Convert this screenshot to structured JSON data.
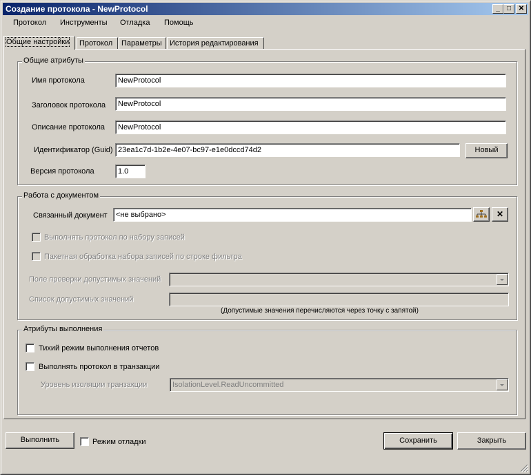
{
  "window": {
    "title": "Создание протокола - NewProtocol",
    "minimize_glyph": "_",
    "maximize_glyph": "□",
    "close_glyph": "✕"
  },
  "menu": [
    "Протокол",
    "Инструменты",
    "Отладка",
    "Помощь"
  ],
  "tabs": [
    "Общие настройки",
    "Протокол",
    "Параметры",
    "История редактирования"
  ],
  "general": {
    "title": "Общие атрибуты",
    "name_label": "Имя протокола",
    "name_value": "NewProtocol",
    "caption_label": "Заголовок протокола",
    "caption_value": "NewProtocol",
    "description_label": "Описание протокола",
    "description_value": "NewProtocol",
    "guid_label": "Идентификатор (Guid)",
    "guid_value": "23ea1c7d-1b2e-4e07-bc97-e1e0dccd74d2",
    "new_button": "Новый",
    "version_label": "Версия протокола",
    "version_value": "1.0"
  },
  "document": {
    "title": "Работа с документом",
    "linked_label": "Связанный документ",
    "linked_value": "<не выбрано>",
    "tree_icon": "tree-icon",
    "clear_glyph": "✕",
    "execute_by_records": "Выполнять протокол  по набору записей",
    "batch_processing": "Пакетная обработка набора записей по строке фильтра",
    "check_field_label": "Поле проверки допустимых значений",
    "check_field_value": "",
    "allowed_list_label": "Список допустимых значений",
    "allowed_list_value": "",
    "allowed_hint": "(Допустимые значения перечисляются через точку с запятой)"
  },
  "execution": {
    "title": "Атрибуты выполнения",
    "silent_mode": "Тихий режим выполнения отчетов",
    "in_transaction": "Выполнять протокол в транзакции",
    "isolation_label": "Уровень изоляции транзакции",
    "isolation_value": "IsolationLevel.ReadUncommitted"
  },
  "footer": {
    "run_button": "Выполнить",
    "debug_mode": "Режим отладки",
    "save_button": "Сохранить",
    "close_button": "Закрыть"
  }
}
